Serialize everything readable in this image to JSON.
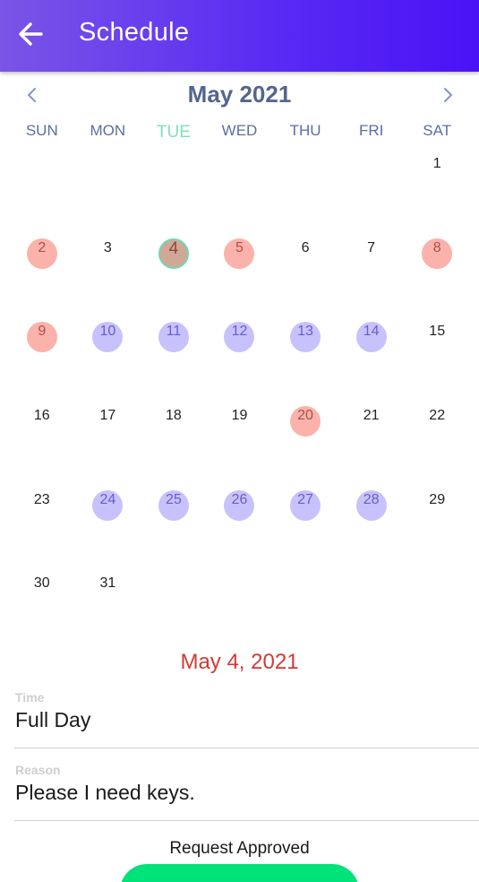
{
  "appbar": {
    "title": "Schedule",
    "back_icon": "arrow-left-icon"
  },
  "calendar": {
    "month_title": "May 2021",
    "prev_icon": "chevron-left-icon",
    "next_icon": "chevron-right-icon",
    "weekdays": [
      "SUN",
      "MON",
      "TUE",
      "WED",
      "THU",
      "FRI",
      "SAT"
    ],
    "today_weekday_index": 2,
    "leading_blank_days": 6,
    "days": [
      {
        "label": "1",
        "state": "none"
      },
      {
        "label": "2",
        "state": "red"
      },
      {
        "label": "3",
        "state": "none"
      },
      {
        "label": "4",
        "state": "selected"
      },
      {
        "label": "5",
        "state": "red"
      },
      {
        "label": "6",
        "state": "none"
      },
      {
        "label": "7",
        "state": "none"
      },
      {
        "label": "8",
        "state": "red"
      },
      {
        "label": "9",
        "state": "red"
      },
      {
        "label": "10",
        "state": "purple"
      },
      {
        "label": "11",
        "state": "purple"
      },
      {
        "label": "12",
        "state": "purple"
      },
      {
        "label": "13",
        "state": "purple"
      },
      {
        "label": "14",
        "state": "purple"
      },
      {
        "label": "15",
        "state": "none"
      },
      {
        "label": "16",
        "state": "none"
      },
      {
        "label": "17",
        "state": "none"
      },
      {
        "label": "18",
        "state": "none"
      },
      {
        "label": "19",
        "state": "none"
      },
      {
        "label": "20",
        "state": "red"
      },
      {
        "label": "21",
        "state": "none"
      },
      {
        "label": "22",
        "state": "none"
      },
      {
        "label": "23",
        "state": "none"
      },
      {
        "label": "24",
        "state": "purple"
      },
      {
        "label": "25",
        "state": "purple"
      },
      {
        "label": "26",
        "state": "purple"
      },
      {
        "label": "27",
        "state": "purple"
      },
      {
        "label": "28",
        "state": "purple"
      },
      {
        "label": "29",
        "state": "none"
      },
      {
        "label": "30",
        "state": "none"
      },
      {
        "label": "31",
        "state": "none"
      }
    ]
  },
  "details": {
    "selected_date": "May 4, 2021",
    "time_label": "Time",
    "time_value": "Full Day",
    "reason_label": "Reason",
    "reason_value": "Please I need keys.",
    "status_text": "Request Approved"
  },
  "colors": {
    "appbar_start": "#7a55e6",
    "appbar_end": "#4a12f6",
    "purple_marker": "#c7c2fb",
    "red_marker": "#fbb2aa",
    "selected_date_text": "#d13a36",
    "approve_button": "#00e27a",
    "today_weekday": "#7ee2b8"
  }
}
